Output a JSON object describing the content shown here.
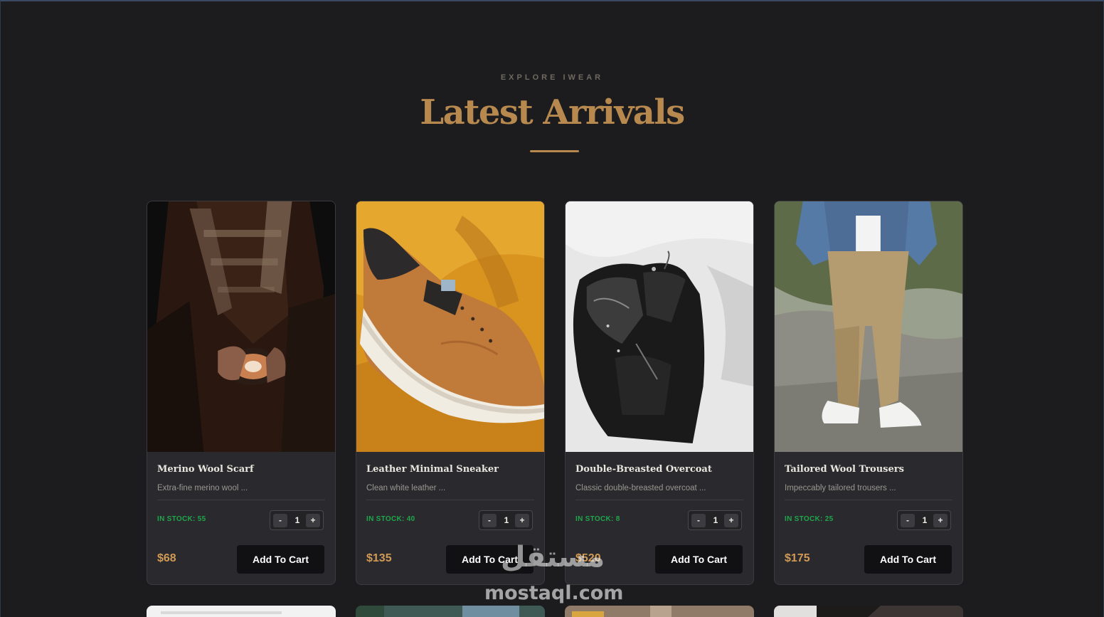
{
  "section": {
    "eyebrow": "EXPLORE IWEAR",
    "title": "Latest Arrivals"
  },
  "products": [
    {
      "name": "Merino Wool Scarf",
      "description": "Extra-fine merino wool ...",
      "stock": "IN STOCK: 55",
      "quantity": "1",
      "price": "$68",
      "cart_label": "Add To Cart",
      "image": "scarf-with-coffee-photo"
    },
    {
      "name": "Leather Minimal Sneaker",
      "description": "Clean white leather ...",
      "stock": "IN STOCK: 40",
      "quantity": "1",
      "price": "$135",
      "cart_label": "Add To Cart",
      "image": "tan-sneaker-photo"
    },
    {
      "name": "Double-Breasted Overcoat",
      "description": "Classic double-breasted overcoat ...",
      "stock": "IN STOCK: 8",
      "quantity": "1",
      "price": "$520",
      "cart_label": "Add To Cart",
      "image": "black-leather-jacket-photo"
    },
    {
      "name": "Tailored Wool Trousers",
      "description": "Impeccably tailored trousers ...",
      "stock": "IN STOCK: 25",
      "quantity": "1",
      "price": "$175",
      "cart_label": "Add To Cart",
      "image": "khaki-trousers-photo"
    }
  ],
  "qty_controls": {
    "minus": "-",
    "plus": "+"
  },
  "watermark": {
    "arabic": "مستقل",
    "latin": "mostaql.com"
  },
  "colors": {
    "background": "#1c1c1f",
    "card": "#2a2a2e",
    "accent_gold": "#b8894f",
    "price": "#d19a55",
    "stock_green": "#1fa64a",
    "button": "#111113"
  }
}
